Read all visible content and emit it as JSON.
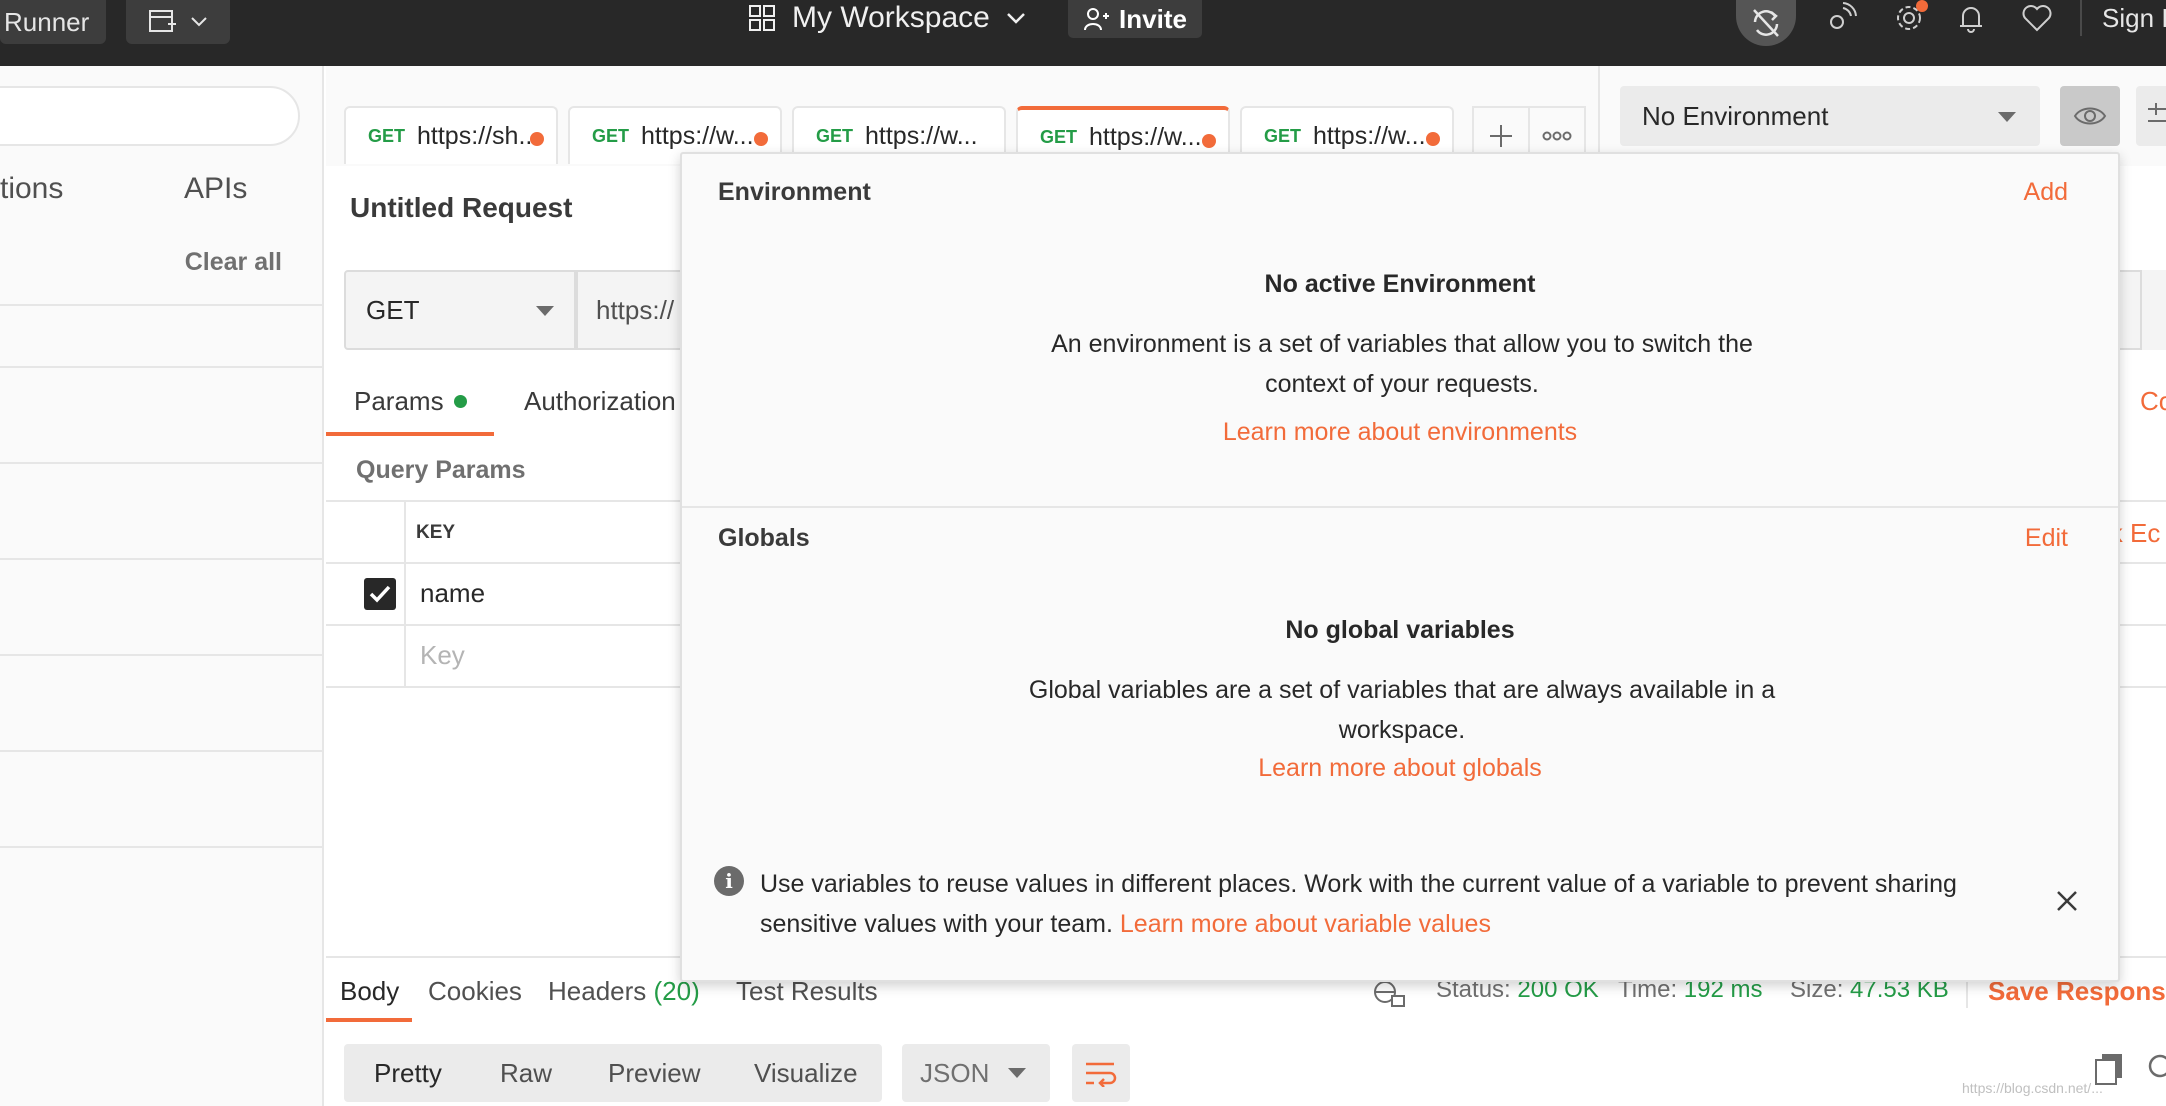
{
  "header": {
    "runner_label": "Runner",
    "workspace_label": "My Workspace",
    "invite_label": "Invite",
    "signin_label": "Sign In",
    "accent_color": "#f26b3a"
  },
  "sidebar": {
    "tabs": [
      "tions",
      "APIs"
    ],
    "clear_label": "Clear all"
  },
  "request_tabs": [
    {
      "method": "GET",
      "url": "https://sh...",
      "unsaved": true,
      "active": false
    },
    {
      "method": "GET",
      "url": "https://w...",
      "unsaved": true,
      "active": false
    },
    {
      "method": "GET",
      "url": "https://w...",
      "unsaved": false,
      "active": false
    },
    {
      "method": "GET",
      "url": "https://w...",
      "unsaved": true,
      "active": true
    },
    {
      "method": "GET",
      "url": "https://w...",
      "unsaved": true,
      "active": false
    }
  ],
  "environment_selector": {
    "selected": "No Environment"
  },
  "request": {
    "name": "Untitled Request",
    "method": "GET",
    "url": "https://",
    "subtabs": [
      "Params",
      "Authorization"
    ],
    "edge_text_tabs": "Co",
    "edge_text_bulk": "lk Ec",
    "query_params_title": "Query Params",
    "col_key": "KEY",
    "rows": [
      {
        "key": "name",
        "checked": true
      }
    ],
    "key_placeholder": "Key"
  },
  "response": {
    "tabs": [
      "Body",
      "Cookies",
      "Headers",
      "Test Results"
    ],
    "headers_count": "(20)",
    "status_label": "Status:",
    "status_value": "200 OK",
    "time_label": "Time:",
    "time_value": "192 ms",
    "size_label": "Size:",
    "size_value": "47.53 KB",
    "save_label": "Save Response",
    "formats": [
      "Pretty",
      "Raw",
      "Preview",
      "Visualize"
    ],
    "format_type": "JSON"
  },
  "popover": {
    "env_title": "Environment",
    "env_action": "Add",
    "env_heading": "No active Environment",
    "env_desc": "An environment is a set of variables that allow you to switch the context of your requests.",
    "env_link": "Learn more about environments",
    "globals_title": "Globals",
    "globals_action": "Edit",
    "globals_heading": "No global variables",
    "globals_desc": "Global variables are a set of variables that are always available in a workspace.",
    "globals_link": "Learn more about globals",
    "info_text": "Use variables to reuse values in different places. Work with the current value of a variable to prevent sharing sensitive values with your team.",
    "info_link": "Learn more about variable values"
  },
  "watermark": "https://blog.csdn.net/..."
}
